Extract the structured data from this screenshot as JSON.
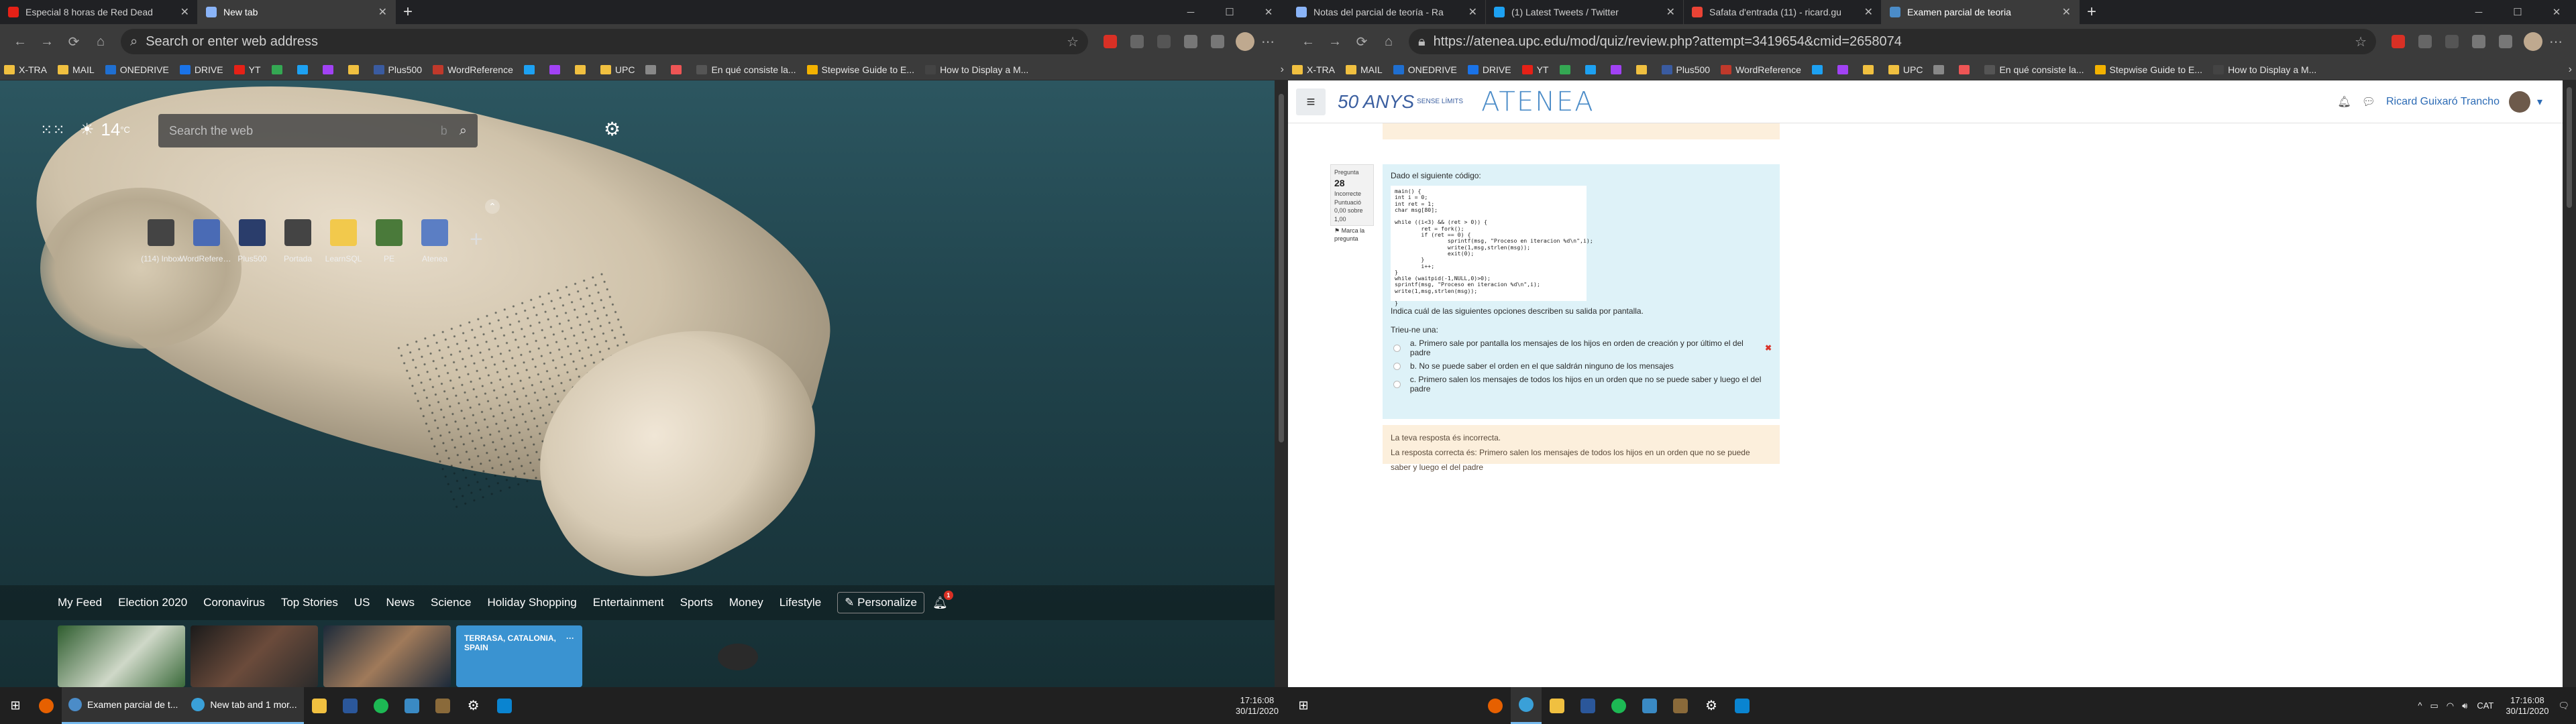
{
  "left": {
    "tabs": [
      {
        "title": "Especial 8 horas de Red Dead",
        "color": "#e62117",
        "active": false
      },
      {
        "title": "New tab",
        "color": "#8ab4f8",
        "active": true
      }
    ],
    "address": {
      "placeholder": "Search or enter web address"
    },
    "bookmarks": [
      "X-TRA",
      "MAIL",
      "ONEDRIVE",
      "DRIVE",
      "YT",
      "",
      "",
      "",
      "",
      "Plus500",
      "WordReference",
      "",
      "",
      "",
      "UPC",
      "",
      "",
      "En qué consiste la...",
      "Stepwise Guide to E...",
      "How to Display a M..."
    ],
    "weather": {
      "temp": "14",
      "unit": "°C"
    },
    "search": {
      "placeholder": "Search the web"
    },
    "top_sites": [
      {
        "label": "(114) Inbox",
        "icon": "inbox-icon",
        "color": "#444"
      },
      {
        "label": "WordReference...",
        "icon": "wordreference-icon",
        "color": "#4a6bb5"
      },
      {
        "label": "Plus500",
        "icon": "plus500-icon",
        "color": "#2a3d6b"
      },
      {
        "label": "Portada",
        "icon": "portada-icon",
        "color": "#444"
      },
      {
        "label": "LearnSQL",
        "icon": "learnsql-icon",
        "color": "#f2c94c"
      },
      {
        "label": "PE",
        "icon": "pe-icon",
        "color": "#4a7a3a"
      },
      {
        "label": "Atenea",
        "icon": "atenea-icon",
        "color": "#5b7ec4"
      }
    ],
    "feed_nav": [
      "My Feed",
      "Election 2020",
      "Coronavirus",
      "Top Stories",
      "US",
      "News",
      "Science",
      "Holiday Shopping",
      "Entertainment",
      "Sports",
      "Money",
      "Lifestyle"
    ],
    "personalize": "Personalize",
    "notif_count": "1",
    "weather_card": "TERRASA, CATALONIA, SPAIN"
  },
  "right": {
    "tabs": [
      {
        "title": "Notas del parcial de teoría - Ra",
        "color": "#8ab4f8",
        "active": false
      },
      {
        "title": "(1) Latest Tweets / Twitter",
        "color": "#1da1f2",
        "active": false
      },
      {
        "title": "Safata d'entrada (11) - ricard.gu",
        "color": "#ea4335",
        "active": false
      },
      {
        "title": "Examen parcial de teoria",
        "color": "#4b8cc8",
        "active": true
      }
    ],
    "address": {
      "url": "https://atenea.upc.edu/mod/quiz/review.php?attempt=3419654&cmid=2658074"
    },
    "bookmarks": [
      "X-TRA",
      "MAIL",
      "ONEDRIVE",
      "DRIVE",
      "YT",
      "",
      "",
      "",
      "",
      "Plus500",
      "WordReference",
      "",
      "",
      "",
      "UPC",
      "",
      "",
      "En qué consiste la...",
      "Stepwise Guide to E...",
      "How to Display a M..."
    ],
    "logo": {
      "years": "50 ANYS",
      "sub": "SENSE LÍMITS",
      "name": "ATENEA"
    },
    "user": "Ricard Guixaró Trancho",
    "question": {
      "label": "Pregunta",
      "number": "28",
      "state": "Incorrecte",
      "score": "Puntuació 0,00 sobre 1,00",
      "flag": "Marca la pregunta",
      "intro": "Dado el siguiente código:",
      "code": "main() {\nint i = 0;\nint ret = 1;\nchar msg[80];\n\nwhile ((i<3) && (ret > 0)) {\n        ret = fork();\n        if (ret == 0) {\n                sprintf(msg, \"Proceso en iteracion %d\\n\",i);\n                write(1,msg,strlen(msg));\n                exit(0);\n        }\n        i++;\n}\nwhile (waitpid(-1,NULL,0)>0);\nsprintf(msg, \"Proceso en iteracion %d\\n\",i);\nwrite(1,msg,strlen(msg));\n\n}",
      "prompt": "Indica cuál de las siguientes opciones describen su salida por pantalla.",
      "choose": "Trieu-ne una:",
      "options": [
        {
          "text": "a. Primero sale por pantalla los mensajes de los hijos en orden de creación y por último el del padre",
          "wrong": true
        },
        {
          "text": "b. No se puede saber el orden en el que saldrán ninguno de los mensajes",
          "wrong": false
        },
        {
          "text": "c. Primero salen los mensajes de todos los hijos en un orden que no se puede saber y luego el del padre",
          "wrong": false
        }
      ],
      "feedback": "La teva resposta és incorrecta.",
      "correct": "La resposta correcta és: Primero salen los mensajes de todos los hijos en un orden que no se puede saber y luego el del padre"
    }
  },
  "taskbar_left": {
    "apps": [
      {
        "label": "Examen parcial de t...",
        "color": "#4b8cc8"
      },
      {
        "label": "New tab and 1 mor...",
        "color": "#3aa0d8"
      }
    ],
    "time": "17:16:08",
    "date": "30/11/2020"
  },
  "taskbar_right": {
    "lang": "CAT",
    "time": "17:16:08",
    "date": "30/11/2020"
  }
}
